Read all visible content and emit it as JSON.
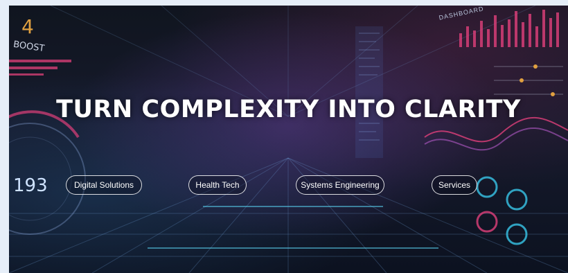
{
  "hero": {
    "headline": "TURN COMPLEXITY INTO CLARITY"
  },
  "nav": [
    {
      "label": "Digital Solutions"
    },
    {
      "label": "Health Tech"
    },
    {
      "label": "Systems Engineering"
    },
    {
      "label": "Services"
    }
  ],
  "hud": {
    "boost_value": "4",
    "boost_label": "BOOST",
    "speed_value": "193",
    "dashboard_label": "DASHBOARD"
  },
  "colors": {
    "headline": "#ffffff",
    "accent_pink": "#e0407a",
    "accent_cyan": "#38c6e8",
    "accent_orange": "#e0a040"
  }
}
